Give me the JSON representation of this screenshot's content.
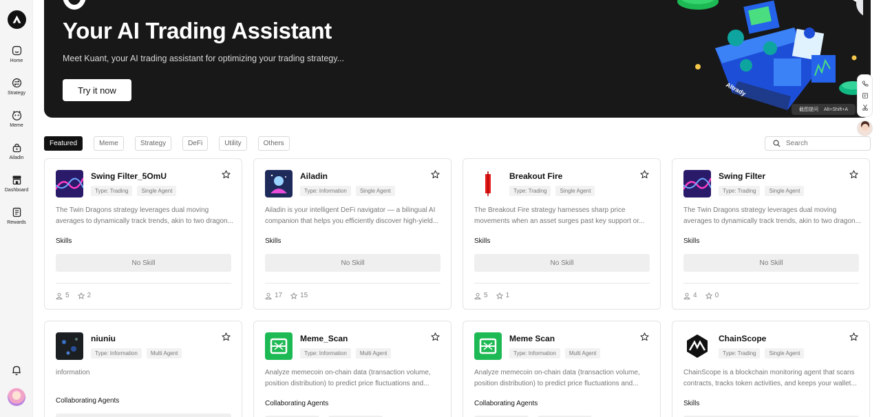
{
  "sidebar": {
    "items": [
      {
        "label": "Home",
        "icon": "home-icon"
      },
      {
        "label": "Strategy",
        "icon": "strategy-icon"
      },
      {
        "label": "Meme",
        "icon": "meme-icon"
      },
      {
        "label": "Ailadin",
        "icon": "ailadin-icon"
      },
      {
        "label": "Dashboard",
        "icon": "dashboard-icon"
      },
      {
        "label": "Rewards",
        "icon": "rewards-icon"
      }
    ]
  },
  "banner": {
    "title": "Your AI Trading Assistant",
    "subtitle": "Meet Kuant, your AI trading assistant for optimizing your trading strategy...",
    "cta": "Try it now",
    "art_text": "Altrady",
    "shortcut_label": "截图提问",
    "shortcut_keys": "Alt+Shift+A"
  },
  "filters": [
    "Featured",
    "Meme",
    "Strategy",
    "DeFi",
    "Utility",
    "Others"
  ],
  "active_filter": "Featured",
  "search": {
    "placeholder": "Search"
  },
  "cards": [
    {
      "name": "Swing Filter_5OmU",
      "type": "Type: Trading",
      "agent": "Single Agent",
      "desc": "The Twin Dragons strategy leverages dual moving averages to dynamically track trends, akin to two dragon...",
      "section": "Skills",
      "skill": "No Skill",
      "users": "5",
      "stars": "2"
    },
    {
      "name": "Ailadin",
      "type": "Type: Information",
      "agent": "Single Agent",
      "desc": "Ailadin is your intelligent DeFi navigator — a bilingual AI companion that helps you efficiently discover high-yield...",
      "section": "Skills",
      "skill": "No Skill",
      "users": "17",
      "stars": "15"
    },
    {
      "name": "Breakout Fire",
      "type": "Type: Trading",
      "agent": "Single Agent",
      "desc": "The Breakout Fire strategy harnesses sharp price movements when an asset surges past key support or...",
      "section": "Skills",
      "skill": "No Skill",
      "users": "5",
      "stars": "1"
    },
    {
      "name": "Swing Filter",
      "type": "Type: Trading",
      "agent": "Single Agent",
      "desc": "The Twin Dragons strategy leverages dual moving averages to dynamically track trends, akin to two dragon...",
      "section": "Skills",
      "skill": "No Skill",
      "users": "4",
      "stars": "0"
    },
    {
      "name": "niuniu",
      "type": "Type: Information",
      "agent": "Multi Agent",
      "desc": "information",
      "section": "Collaborating Agents"
    },
    {
      "name": "Meme_Scan",
      "type": "Type: Information",
      "agent": "Multi Agent",
      "desc": "Analyze memecoin on-chain data (transaction volume, position distribution) to predict price fluctuations and...",
      "section": "Collaborating Agents"
    },
    {
      "name": "Meme Scan",
      "type": "Type: Information",
      "agent": "Multi Agent",
      "desc": "Analyze memecoin on-chain data (transaction volume, position distribution) to predict price fluctuations and...",
      "section": "Collaborating Agents"
    },
    {
      "name": "ChainScope",
      "type": "Type: Trading",
      "agent": "Single Agent",
      "desc": "ChainScope is a blockchain monitoring agent that scans contracts, tracks token activities, and keeps your wallet...",
      "section": "Skills"
    }
  ],
  "colors": {
    "banner_bg": "#181818",
    "accent_blue": "#2a6ef0",
    "chip_active": "#111111",
    "meme_green": "#1db954"
  }
}
